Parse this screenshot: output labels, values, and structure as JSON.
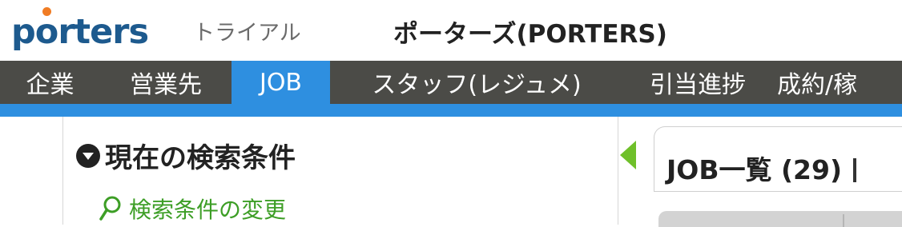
{
  "header": {
    "logo_text": "porters",
    "plan_label": "トライアル",
    "company_name": "ポーターズ(PORTERS)"
  },
  "nav": {
    "tabs": [
      {
        "label": "企業",
        "active": false
      },
      {
        "label": "営業先",
        "active": false
      },
      {
        "label": "JOB",
        "active": true
      },
      {
        "label": "スタッフ(レジュメ)",
        "active": false
      },
      {
        "label": "引当進捗",
        "active": false
      },
      {
        "label": "成約/稼",
        "active": false
      }
    ]
  },
  "search_panel": {
    "title": "現在の検索条件",
    "change_link": "検索条件の変更"
  },
  "list_panel": {
    "title": "JOB一覧 (29)"
  },
  "colors": {
    "brand_blue": "#1d5a8e",
    "logo_dot": "#f07c24",
    "nav_bg": "#4b4b47",
    "active_tab": "#2e8fe0",
    "link_green": "#3d9e26",
    "arrow_green": "#6fc02a"
  },
  "icons": {
    "collapse_toggle": "circle-triangle-down-icon",
    "search_link": "magnifier-icon",
    "panel_toggle": "triangle-left-icon"
  }
}
